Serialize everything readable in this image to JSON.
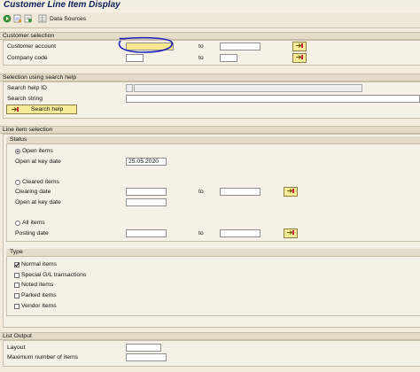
{
  "window": {
    "title": "Customer Line Item Display"
  },
  "toolbar": {
    "data_sources_label": "Data Sources",
    "icons": [
      "execute-icon",
      "save-variant-icon",
      "get-variant-icon",
      "data-sources-icon"
    ]
  },
  "customer_selection": {
    "header": "Customer selection",
    "customer_account_label": "Customer account",
    "customer_account_value": "",
    "company_code_label": "Company code",
    "to_label": "to"
  },
  "search_help": {
    "header": "Selection using search help",
    "search_help_id_label": "Search help ID",
    "search_string_label": "Search string",
    "button_label": "Search help"
  },
  "line_item_selection": {
    "header": "Line item selection",
    "status": {
      "header": "Status",
      "open_items_label": "Open items",
      "open_at_key_date_label": "Open at key date",
      "open_at_key_date_value": "25.05.2020",
      "cleared_items_label": "Cleared items",
      "clearing_date_label": "Clearing date",
      "cleared_open_at_key_date_label": "Open at key date",
      "all_items_label": "All items",
      "posting_date_label": "Posting date",
      "to_label": "to"
    },
    "type": {
      "header": "Type",
      "normal_items": "Normal items",
      "special_gl": "Special G/L transactions",
      "noted_items": "Noted items",
      "parked_items": "Parked items",
      "vendor_items": "Vendor items"
    }
  },
  "list_output": {
    "header": "List Output",
    "layout_label": "Layout",
    "max_items_label": "Maximum number of items"
  },
  "colors": {
    "background": "#f3ecdc",
    "required_field": "#f8e890",
    "annotation_circle": "#1b1fb8",
    "title": "#0a1e5a"
  }
}
